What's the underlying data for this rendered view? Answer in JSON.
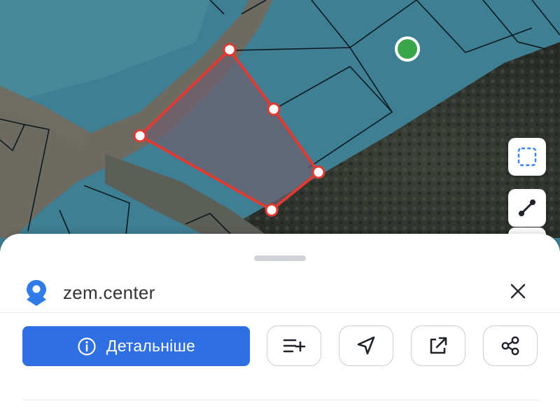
{
  "map": {
    "selected_parcel": {
      "outline_color": "#e03a33",
      "fill_color": "rgba(110,95,110,0.72)"
    },
    "location_marker": {
      "icon": "green-dot",
      "color": "#3ba54a"
    }
  },
  "map_tools": [
    {
      "icon": "select-area-icon",
      "color": "#3b82f6"
    },
    {
      "icon": "measure-line-icon",
      "color": "#1f2329"
    }
  ],
  "sheet": {
    "source_icon": "map-pin-icon",
    "title": "zem.center",
    "close_icon": "close-icon",
    "primary_button": {
      "icon": "info-icon",
      "label": "Детальніше",
      "color": "#2f6fe4"
    },
    "actions": [
      {
        "icon": "add-to-list-icon"
      },
      {
        "icon": "navigate-icon"
      },
      {
        "icon": "open-external-icon"
      },
      {
        "icon": "share-icon"
      }
    ]
  }
}
